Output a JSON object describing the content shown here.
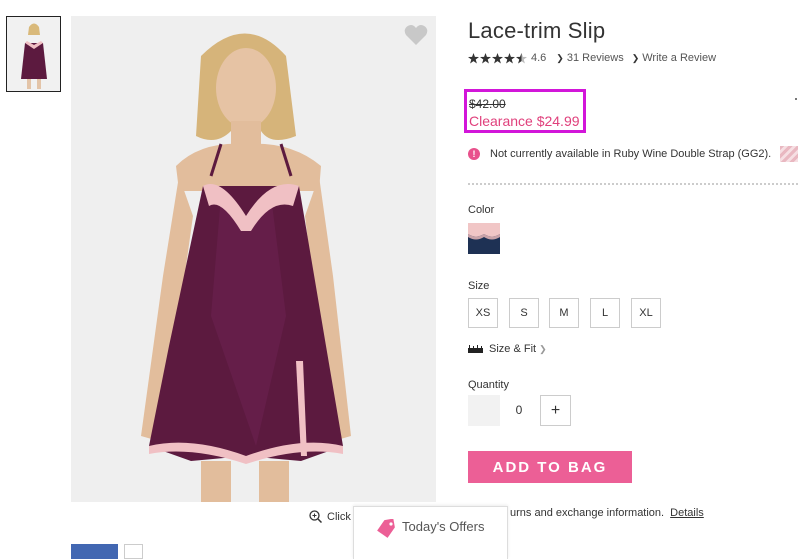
{
  "product": {
    "title": "Lace-trim Slip",
    "rating": "4.6",
    "reviews_label": "31 Reviews",
    "write_review_label": "Write a Review",
    "original_price": "$42.00",
    "clearance_price": "Clearance $24.99",
    "availability": "Not currently available in Ruby Wine Double Strap (GG2)."
  },
  "options": {
    "color_label": "Color",
    "size_label": "Size",
    "sizes": [
      "XS",
      "S",
      "M",
      "L",
      "XL"
    ],
    "size_fit_label": "Size & Fit",
    "quantity_label": "Quantity",
    "quantity_value": "0",
    "plus_symbol": "+"
  },
  "actions": {
    "add_to_bag": "ADD TO BAG"
  },
  "footer": {
    "zoom_label": "Click",
    "returns_text": "urns and exchange information.",
    "details_link": "Details",
    "offers_label": "Today's Offers"
  },
  "colors": {
    "accent_pink": "#ec5f96",
    "clearance": "#e0407c",
    "highlight_box": "#d216d9",
    "garment": "#5c1a3f"
  },
  "icons": [
    "heart-icon",
    "star-icon",
    "chevron-right-icon",
    "alert-icon",
    "ruler-icon",
    "zoom-icon",
    "tag-icon"
  ]
}
